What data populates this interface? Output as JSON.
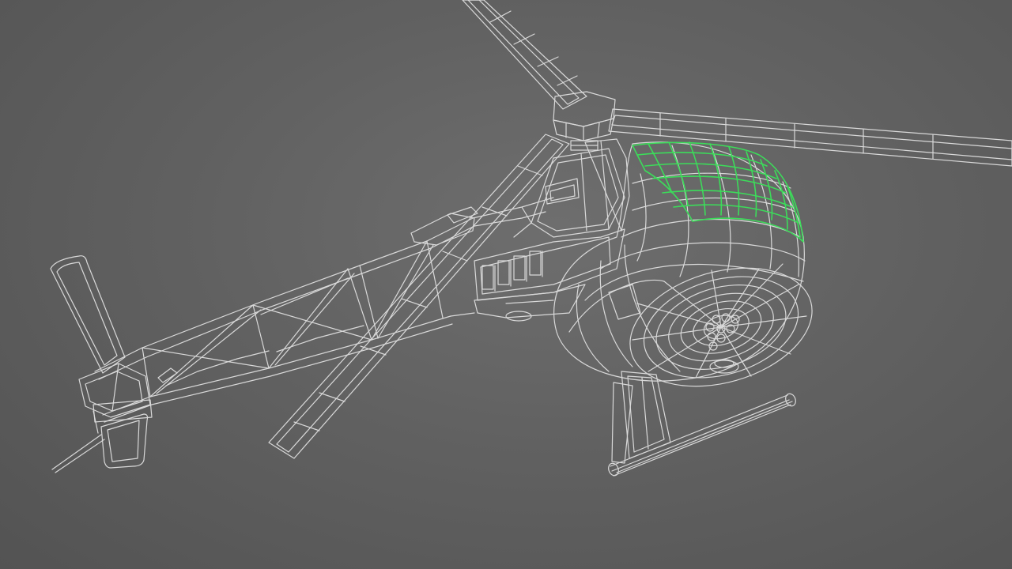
{
  "viewport": {
    "background": "#616161",
    "wire_color": "#d9d9d9",
    "selection_color": "#3cdc5a",
    "model": "helicopter-wireframe",
    "selected_part": "canopy-faces"
  }
}
